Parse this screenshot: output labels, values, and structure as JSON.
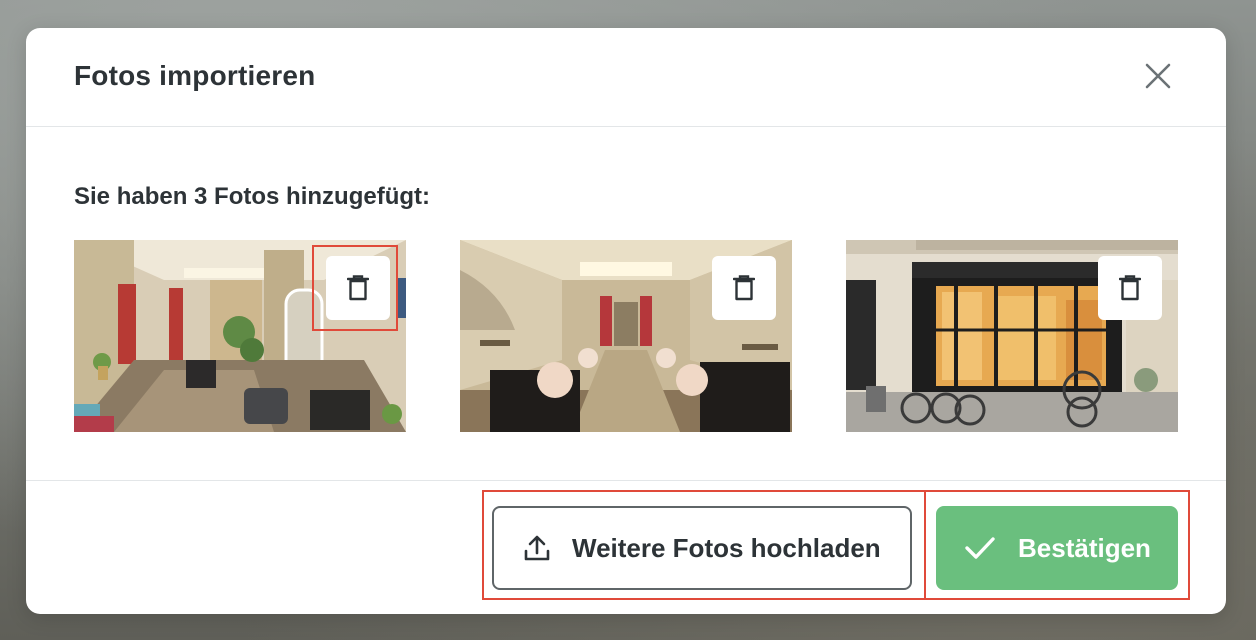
{
  "modal": {
    "title": "Fotos importieren",
    "close_icon": "close-icon"
  },
  "body": {
    "subtitle": "Sie haben 3 Fotos hinzugefügt:",
    "photos": [
      {
        "name": "salon-interior-styling-area",
        "delete_icon": "trash-icon"
      },
      {
        "name": "salon-interior-wash-area",
        "delete_icon": "trash-icon"
      },
      {
        "name": "salon-storefront-exterior",
        "delete_icon": "trash-icon"
      }
    ]
  },
  "footer": {
    "upload_label": "Weitere Fotos hochladen",
    "upload_icon": "upload-icon",
    "confirm_label": "Bestätigen",
    "confirm_icon": "checkmark-icon"
  },
  "colors": {
    "confirm": "#6abf7e",
    "highlight": "#e04a3a",
    "text": "#2d3337"
  }
}
